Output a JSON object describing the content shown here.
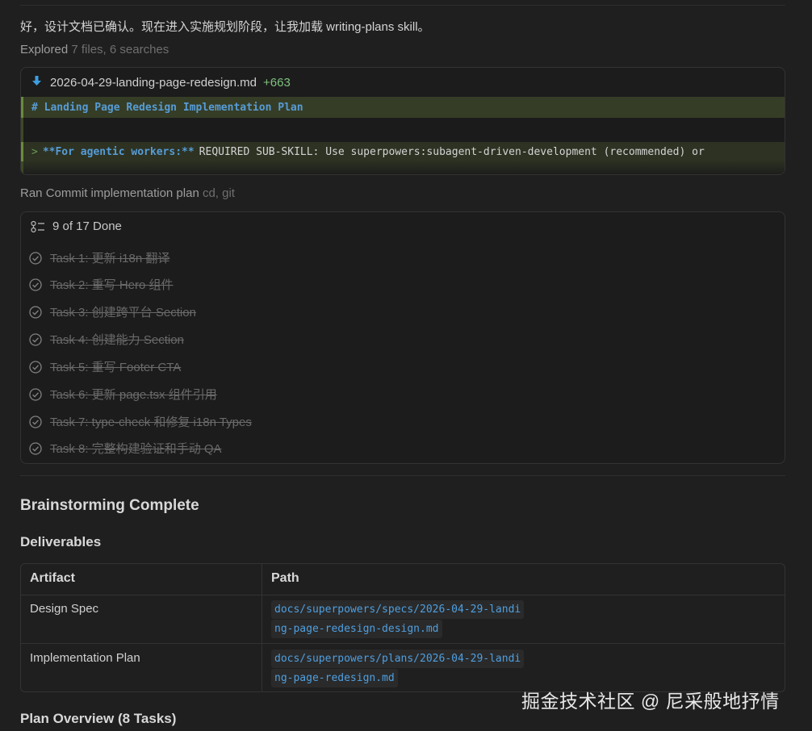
{
  "intro": "好，设计文档已确认。现在进入实施规划阶段，让我加载 writing-plans skill。",
  "explored": {
    "label": "Explored",
    "detail": "7 files, 6 searches"
  },
  "diff": {
    "filename": "2026-04-29-landing-page-redesign.md",
    "additions": "+663",
    "line1": "# Landing Page Redesign Implementation Plan",
    "line2_prefix": ">",
    "line2_bold": "**For agentic workers:**",
    "line2_text": "REQUIRED SUB-SKILL: Use superpowers:subagent-driven-development (recommended) or"
  },
  "ran": {
    "label": "Ran",
    "title": "Commit implementation plan",
    "detail": "cd, git"
  },
  "tasks": {
    "summary": "9 of 17 Done",
    "items": [
      "Task 1: 更新 i18n 翻译",
      "Task 2: 重写 Hero 组件",
      "Task 3: 创建跨平台 Section",
      "Task 4: 创建能力 Section",
      "Task 5: 重写 Footer CTA",
      "Task 6: 更新 page.tsx 组件引用",
      "Task 7: type-check 和修复 i18n Types",
      "Task 8: 完整构建验证和手动 QA"
    ]
  },
  "heading_complete": "Brainstorming Complete",
  "heading_deliverables": "Deliverables",
  "table": {
    "headers": [
      "Artifact",
      "Path"
    ],
    "rows": [
      {
        "artifact": "Design Spec",
        "path1": "docs/superpowers/specs/2026-04-29-landi",
        "path2": "ng-page-redesign-design.md"
      },
      {
        "artifact": "Implementation Plan",
        "path1": "docs/superpowers/plans/2026-04-29-landi",
        "path2": "ng-page-redesign.md"
      }
    ]
  },
  "heading_overview": "Plan Overview (8 Tasks)",
  "watermark": "掘金技术社区 @ 尼采般地抒情",
  "colors": {
    "background": "#1f1f1f",
    "accent_blue": "#569cd6",
    "diff_green": "#363d26",
    "additions": "#7ec27e"
  }
}
